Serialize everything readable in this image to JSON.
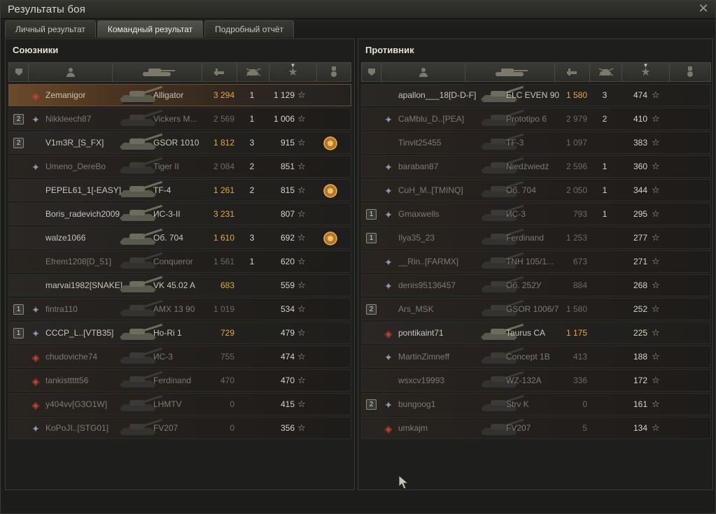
{
  "window": {
    "title": "Результаты боя"
  },
  "tabs": [
    {
      "label": "Личный результат",
      "active": false
    },
    {
      "label": "Командный результат",
      "active": true
    },
    {
      "label": "Подробный отчёт",
      "active": false
    }
  ],
  "allies": {
    "title": "Союзники",
    "rows": [
      {
        "squad": "",
        "rank": "diamond",
        "name": "Zemanigor",
        "tank": "Alligator",
        "damage": "3 294",
        "kills": "1",
        "xp": "1 129",
        "medal": false,
        "alive": true,
        "highlight": true
      },
      {
        "squad": "2",
        "rank": "clan",
        "name": "Nikkleech87",
        "tank": "Vickers M...",
        "damage": "2 569",
        "kills": "1",
        "xp": "1 006",
        "medal": false,
        "alive": false
      },
      {
        "squad": "2",
        "rank": "",
        "name": "V1m3R_[S_FX]",
        "tank": "GSOR 1010",
        "damage": "1 812",
        "kills": "3",
        "xp": "915",
        "medal": true,
        "alive": true
      },
      {
        "squad": "",
        "rank": "clan",
        "name": "Umeno_DereBo",
        "tank": "Tiger II",
        "damage": "2 084",
        "kills": "2",
        "xp": "851",
        "medal": false,
        "alive": false
      },
      {
        "squad": "",
        "rank": "",
        "name": "PEPEL61_1[-EASY]",
        "tank": "TF-4",
        "damage": "1 261",
        "kills": "2",
        "xp": "815",
        "medal": true,
        "alive": true
      },
      {
        "squad": "",
        "rank": "",
        "name": "Boris_radevich2009",
        "tank": "ИС-3-II",
        "damage": "3 231",
        "kills": "",
        "xp": "807",
        "medal": false,
        "alive": true
      },
      {
        "squad": "",
        "rank": "",
        "name": "walze1066",
        "tank": "Об. 704",
        "damage": "1 610",
        "kills": "3",
        "xp": "692",
        "medal": true,
        "alive": true
      },
      {
        "squad": "",
        "rank": "",
        "name": "Efrem1208[D_51]",
        "tank": "Conqueror",
        "damage": "1 561",
        "kills": "1",
        "xp": "620",
        "medal": false,
        "alive": false
      },
      {
        "squad": "",
        "rank": "",
        "name": "marvai1982[SNAKE]",
        "tank": "VK 45.02 A",
        "damage": "683",
        "kills": "",
        "xp": "559",
        "medal": false,
        "alive": true
      },
      {
        "squad": "1",
        "rank": "clan",
        "name": "fintra110",
        "tank": "AMX 13 90",
        "damage": "1 019",
        "kills": "",
        "xp": "534",
        "medal": false,
        "alive": false
      },
      {
        "squad": "1",
        "rank": "clan",
        "name": "CCCP_L..[VTB35]",
        "tank": "Ho-Ri 1",
        "damage": "729",
        "kills": "",
        "xp": "479",
        "medal": false,
        "alive": true
      },
      {
        "squad": "",
        "rank": "diamond",
        "name": "chudoviche74",
        "tank": "ИС-3",
        "damage": "755",
        "kills": "",
        "xp": "474",
        "medal": false,
        "alive": false
      },
      {
        "squad": "",
        "rank": "diamond",
        "name": "tankisttttt56",
        "tank": "Ferdinand",
        "damage": "470",
        "kills": "",
        "xp": "470",
        "medal": false,
        "alive": false
      },
      {
        "squad": "",
        "rank": "diamond",
        "name": "y404vv[G3O1W]",
        "tank": "LHMTV",
        "damage": "0",
        "kills": "",
        "xp": "415",
        "medal": false,
        "alive": false
      },
      {
        "squad": "",
        "rank": "clan",
        "name": "KoPoJI..[STG01]",
        "tank": "FV207",
        "damage": "0",
        "kills": "",
        "xp": "356",
        "medal": false,
        "alive": false
      }
    ]
  },
  "enemies": {
    "title": "Противник",
    "rows": [
      {
        "squad": "",
        "rank": "",
        "name": "apallon___18[D-D-F]",
        "tank": "ELC EVEN 90",
        "damage": "1 580",
        "kills": "3",
        "xp": "474",
        "medal": false,
        "alive": true
      },
      {
        "squad": "",
        "rank": "clan",
        "name": "CaMblu_D..[PEA]",
        "tank": "Prototipo 6",
        "damage": "2 979",
        "kills": "2",
        "xp": "410",
        "medal": false,
        "alive": false
      },
      {
        "squad": "",
        "rank": "",
        "name": "Tinvit25455",
        "tank": "TF-3",
        "damage": "1 097",
        "kills": "",
        "xp": "383",
        "medal": false,
        "alive": false
      },
      {
        "squad": "",
        "rank": "clan",
        "name": "baraban87",
        "tank": "Niedźwiedź",
        "damage": "2 596",
        "kills": "1",
        "xp": "360",
        "medal": false,
        "alive": false
      },
      {
        "squad": "",
        "rank": "clan",
        "name": "CuH_M..[TMINQ]",
        "tank": "Об. 704",
        "damage": "2 050",
        "kills": "1",
        "xp": "344",
        "medal": false,
        "alive": false
      },
      {
        "squad": "1",
        "rank": "clan",
        "name": "Gmaxwells",
        "tank": "ИС-3",
        "damage": "793",
        "kills": "1",
        "xp": "295",
        "medal": false,
        "alive": false
      },
      {
        "squad": "1",
        "rank": "",
        "name": "Ilya35_23",
        "tank": "Ferdinand",
        "damage": "1 253",
        "kills": "",
        "xp": "277",
        "medal": false,
        "alive": false
      },
      {
        "squad": "",
        "rank": "clan",
        "name": "__Rin..[FARMX]",
        "tank": "TNH 105/1...",
        "damage": "673",
        "kills": "",
        "xp": "271",
        "medal": false,
        "alive": false
      },
      {
        "squad": "",
        "rank": "clan",
        "name": "denis95136457",
        "tank": "Об. 252У",
        "damage": "884",
        "kills": "",
        "xp": "268",
        "medal": false,
        "alive": false
      },
      {
        "squad": "2",
        "rank": "",
        "name": "Ars_MSK",
        "tank": "GSOR 1006/7",
        "damage": "1 580",
        "kills": "",
        "xp": "252",
        "medal": false,
        "alive": false
      },
      {
        "squad": "",
        "rank": "diamond",
        "name": "pontikaint71",
        "tank": "Taurus CA",
        "damage": "1 175",
        "kills": "",
        "xp": "225",
        "medal": false,
        "alive": true
      },
      {
        "squad": "",
        "rank": "clan",
        "name": "MartinZimneff",
        "tank": "Concept 1B",
        "damage": "413",
        "kills": "",
        "xp": "188",
        "medal": false,
        "alive": false
      },
      {
        "squad": "",
        "rank": "",
        "name": "wsxcv19993",
        "tank": "WZ-132A",
        "damage": "336",
        "kills": "",
        "xp": "172",
        "medal": false,
        "alive": false
      },
      {
        "squad": "2",
        "rank": "clan",
        "name": "bungoog1",
        "tank": "Strv K",
        "damage": "0",
        "kills": "",
        "xp": "161",
        "medal": false,
        "alive": false
      },
      {
        "squad": "",
        "rank": "diamond",
        "name": "umkajm",
        "tank": "FV207",
        "damage": "5",
        "kills": "",
        "xp": "134",
        "medal": false,
        "alive": false
      }
    ]
  },
  "icons": {
    "close": "close-icon",
    "squad": "squad-icon",
    "player": "player-icon",
    "tank": "tank-icon",
    "damage": "damage-icon",
    "kills": "kills-icon",
    "xp": "xp-star-icon",
    "medal": "medal-icon"
  },
  "colors": {
    "damage": "#e0a840",
    "highlight": "#6a4a2a"
  }
}
